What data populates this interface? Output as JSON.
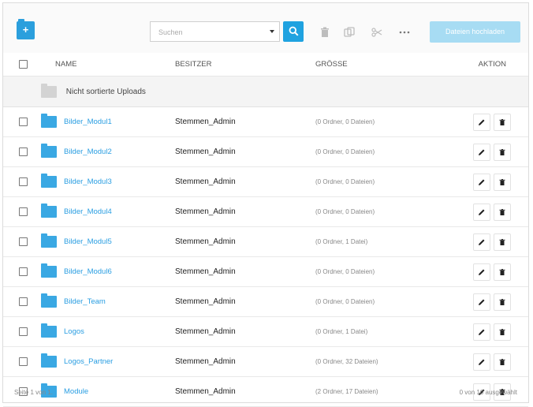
{
  "toolbar": {
    "search_placeholder": "Suchen",
    "upload_label": "Dateien hochladen"
  },
  "table": {
    "headers": {
      "name": "NAME",
      "owner": "BESITZER",
      "size": "GRÖSSE",
      "action": "AKTION"
    },
    "unsorted_label": "Nicht sortierte Uploads",
    "rows": [
      {
        "name": "Bilder_Modul1",
        "owner": "Stemmen_Admin",
        "size": "(0 Ordner, 0 Dateien)"
      },
      {
        "name": "Bilder_Modul2",
        "owner": "Stemmen_Admin",
        "size": "(0 Ordner, 0 Dateien)"
      },
      {
        "name": "Bilder_Modul3",
        "owner": "Stemmen_Admin",
        "size": "(0 Ordner, 0 Dateien)"
      },
      {
        "name": "Bilder_Modul4",
        "owner": "Stemmen_Admin",
        "size": "(0 Ordner, 0 Dateien)"
      },
      {
        "name": "Bilder_Modul5",
        "owner": "Stemmen_Admin",
        "size": "(0 Ordner, 1 Datei)"
      },
      {
        "name": "Bilder_Modul6",
        "owner": "Stemmen_Admin",
        "size": "(0 Ordner, 0 Dateien)"
      },
      {
        "name": "Bilder_Team",
        "owner": "Stemmen_Admin",
        "size": "(0 Ordner, 0 Dateien)"
      },
      {
        "name": "Logos",
        "owner": "Stemmen_Admin",
        "size": "(0 Ordner, 1 Datei)"
      },
      {
        "name": "Logos_Partner",
        "owner": "Stemmen_Admin",
        "size": "(0 Ordner, 32 Dateien)"
      },
      {
        "name": "Module",
        "owner": "Stemmen_Admin",
        "size": "(2 Ordner, 17 Dateien)"
      }
    ]
  },
  "footer": {
    "page_info": "Seite 1 von 1.",
    "selection_info": "0 von 10 ausgewählt"
  },
  "colors": {
    "accent": "#1fa2e0",
    "folder": "#3aa8e3",
    "upload_disabled": "#a7dcf3"
  }
}
